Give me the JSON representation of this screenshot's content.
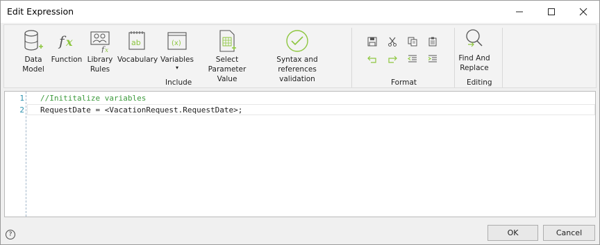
{
  "window": {
    "title": "Edit Expression"
  },
  "ribbon": {
    "include_buttons": [
      {
        "line1": "Data",
        "line2": "Model"
      },
      {
        "line1": "Function",
        "line2": ""
      },
      {
        "line1": "Library",
        "line2": "Rules"
      },
      {
        "line1": "Vocabulary",
        "line2": ""
      },
      {
        "line1": "Variables",
        "line2": "▾"
      },
      {
        "line1": "Select Parameter",
        "line2": "Value"
      },
      {
        "line1": "Syntax and references",
        "line2": "validation"
      }
    ],
    "include_label": "Include",
    "format_label": "Format",
    "editing_button": {
      "line1": "Find And",
      "line2": "Replace"
    },
    "editing_label": "Editing"
  },
  "editor": {
    "lines": [
      {
        "num": "1",
        "text": "//Inititalize variables"
      },
      {
        "num": "2",
        "text": "RequestDate = <VacationRequest.RequestDate>;"
      }
    ]
  },
  "footer": {
    "ok_label": "OK",
    "cancel_label": "Cancel",
    "help_label": "?"
  },
  "colors": {
    "icon_green": "#8dc63f",
    "comment_green": "#3c9a3c",
    "line_number_blue": "#2b91af"
  }
}
